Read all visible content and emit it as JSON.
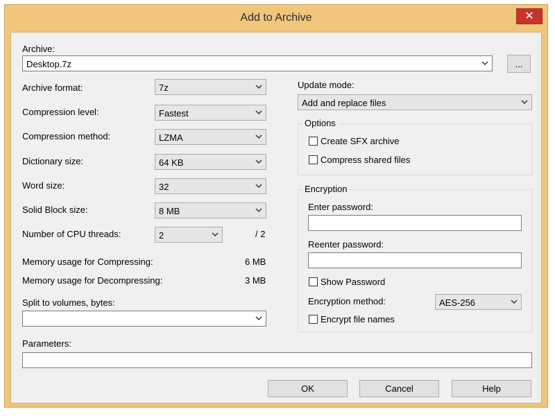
{
  "window": {
    "title": "Add to Archive",
    "close_glyph": "✕"
  },
  "archive": {
    "label": "Archive:",
    "value": "Desktop.7z",
    "browse_label": "..."
  },
  "left": {
    "format": {
      "label": "Archive format:",
      "value": "7z"
    },
    "level": {
      "label": "Compression level:",
      "value": "Fastest"
    },
    "method": {
      "label": "Compression method:",
      "value": "LZMA"
    },
    "dict": {
      "label": "Dictionary size:",
      "value": "64 KB"
    },
    "word": {
      "label": "Word size:",
      "value": "32"
    },
    "solid": {
      "label": "Solid Block size:",
      "value": "8 MB"
    },
    "threads": {
      "label": "Number of CPU threads:",
      "value": "2",
      "max": "/ 2"
    },
    "mem_compress": {
      "label": "Memory usage for Compressing:",
      "value": "6 MB"
    },
    "mem_decompress": {
      "label": "Memory usage for Decompressing:",
      "value": "3 MB"
    },
    "split": {
      "label": "Split to volumes, bytes:",
      "value": ""
    }
  },
  "right": {
    "update": {
      "label": "Update mode:",
      "value": "Add and replace files"
    },
    "options": {
      "title": "Options",
      "sfx": "Create SFX archive",
      "shared": "Compress shared files"
    },
    "encryption": {
      "title": "Encryption",
      "enter_label": "Enter password:",
      "reenter_label": "Reenter password:",
      "show": "Show Password",
      "method_label": "Encryption method:",
      "method_value": "AES-256",
      "names": "Encrypt file names"
    }
  },
  "parameters": {
    "label": "Parameters:",
    "value": ""
  },
  "buttons": {
    "ok": "OK",
    "cancel": "Cancel",
    "help": "Help"
  },
  "colors": {
    "frame": "#f0c57c",
    "close": "#c7342c",
    "dialog": "#f0f0f0"
  },
  "icons": {
    "combo_arrow": "chevron-down-icon",
    "close": "close-icon"
  }
}
